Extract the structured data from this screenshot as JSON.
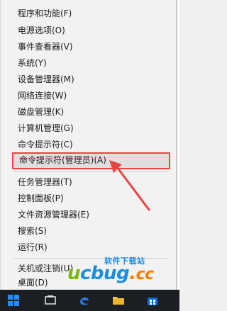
{
  "menu": {
    "items": [
      {
        "label": "程序和功能(F)"
      },
      {
        "label": "电源选项(O)"
      },
      {
        "label": "事件查看器(V)"
      },
      {
        "label": "系统(Y)"
      },
      {
        "label": "设备管理器(M)"
      },
      {
        "label": "网络连接(W)"
      },
      {
        "label": "磁盘管理(K)"
      },
      {
        "label": "计算机管理(G)"
      },
      {
        "label": "命令提示符(C)"
      },
      {
        "label": "命令提示符(管理员)(A)"
      },
      {
        "label": "任务管理器(T)"
      },
      {
        "label": "控制面板(P)"
      },
      {
        "label": "文件资源管理器(E)"
      },
      {
        "label": "搜索(S)"
      },
      {
        "label": "运行(R)"
      },
      {
        "label": "关机或注销(U)"
      },
      {
        "label": "桌面(D)"
      }
    ],
    "selected_index": 9
  },
  "watermark": {
    "top_text": "软件下载站",
    "main_u": "u",
    "main_text": "cbug",
    "main_dot": ".",
    "main_cc": "cc"
  },
  "colors": {
    "menu_bg": "#f2f2f2",
    "highlight_border": "#e84545",
    "taskbar_bg": "#1b1e23",
    "arrow": "#e84545",
    "windows_blue": "#1e90ff"
  },
  "taskbar": {
    "icons": [
      "windows-start-icon",
      "task-view-icon",
      "edge-icon",
      "file-explorer-icon",
      "store-icon"
    ]
  }
}
